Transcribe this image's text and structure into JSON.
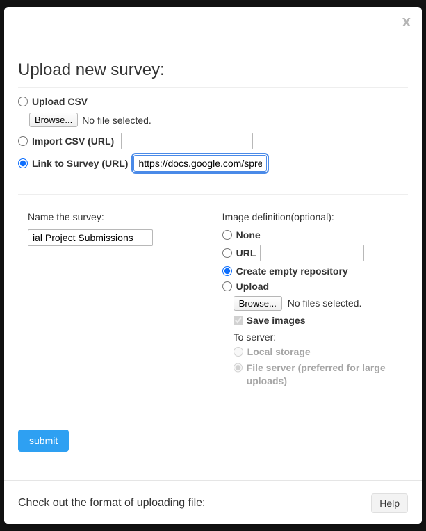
{
  "modal": {
    "close_label": "x",
    "title": "Upload new survey:"
  },
  "source": {
    "upload_csv": {
      "label": "Upload CSV",
      "browse": "Browse...",
      "status": "No file selected."
    },
    "import_csv_url": {
      "label": "Import CSV (URL)",
      "value": ""
    },
    "link_survey_url": {
      "label": "Link to Survey (URL)",
      "value": "https://docs.google.com/spreadsheets"
    }
  },
  "name": {
    "label": "Name the survey:",
    "value": "ial Project Submissions"
  },
  "image_def": {
    "title": "Image definition(optional):",
    "none": "None",
    "url": "URL",
    "url_value": "",
    "create_empty": "Create empty repository",
    "upload": {
      "label": "Upload",
      "browse": "Browse...",
      "status": "No files selected."
    },
    "save_images": "Save images",
    "to_server": "To server:",
    "local_storage": "Local storage",
    "file_server": "File server (preferred for large uploads)"
  },
  "actions": {
    "submit": "submit"
  },
  "footer": {
    "text": "Check out the format of uploading file:",
    "help": "Help"
  }
}
